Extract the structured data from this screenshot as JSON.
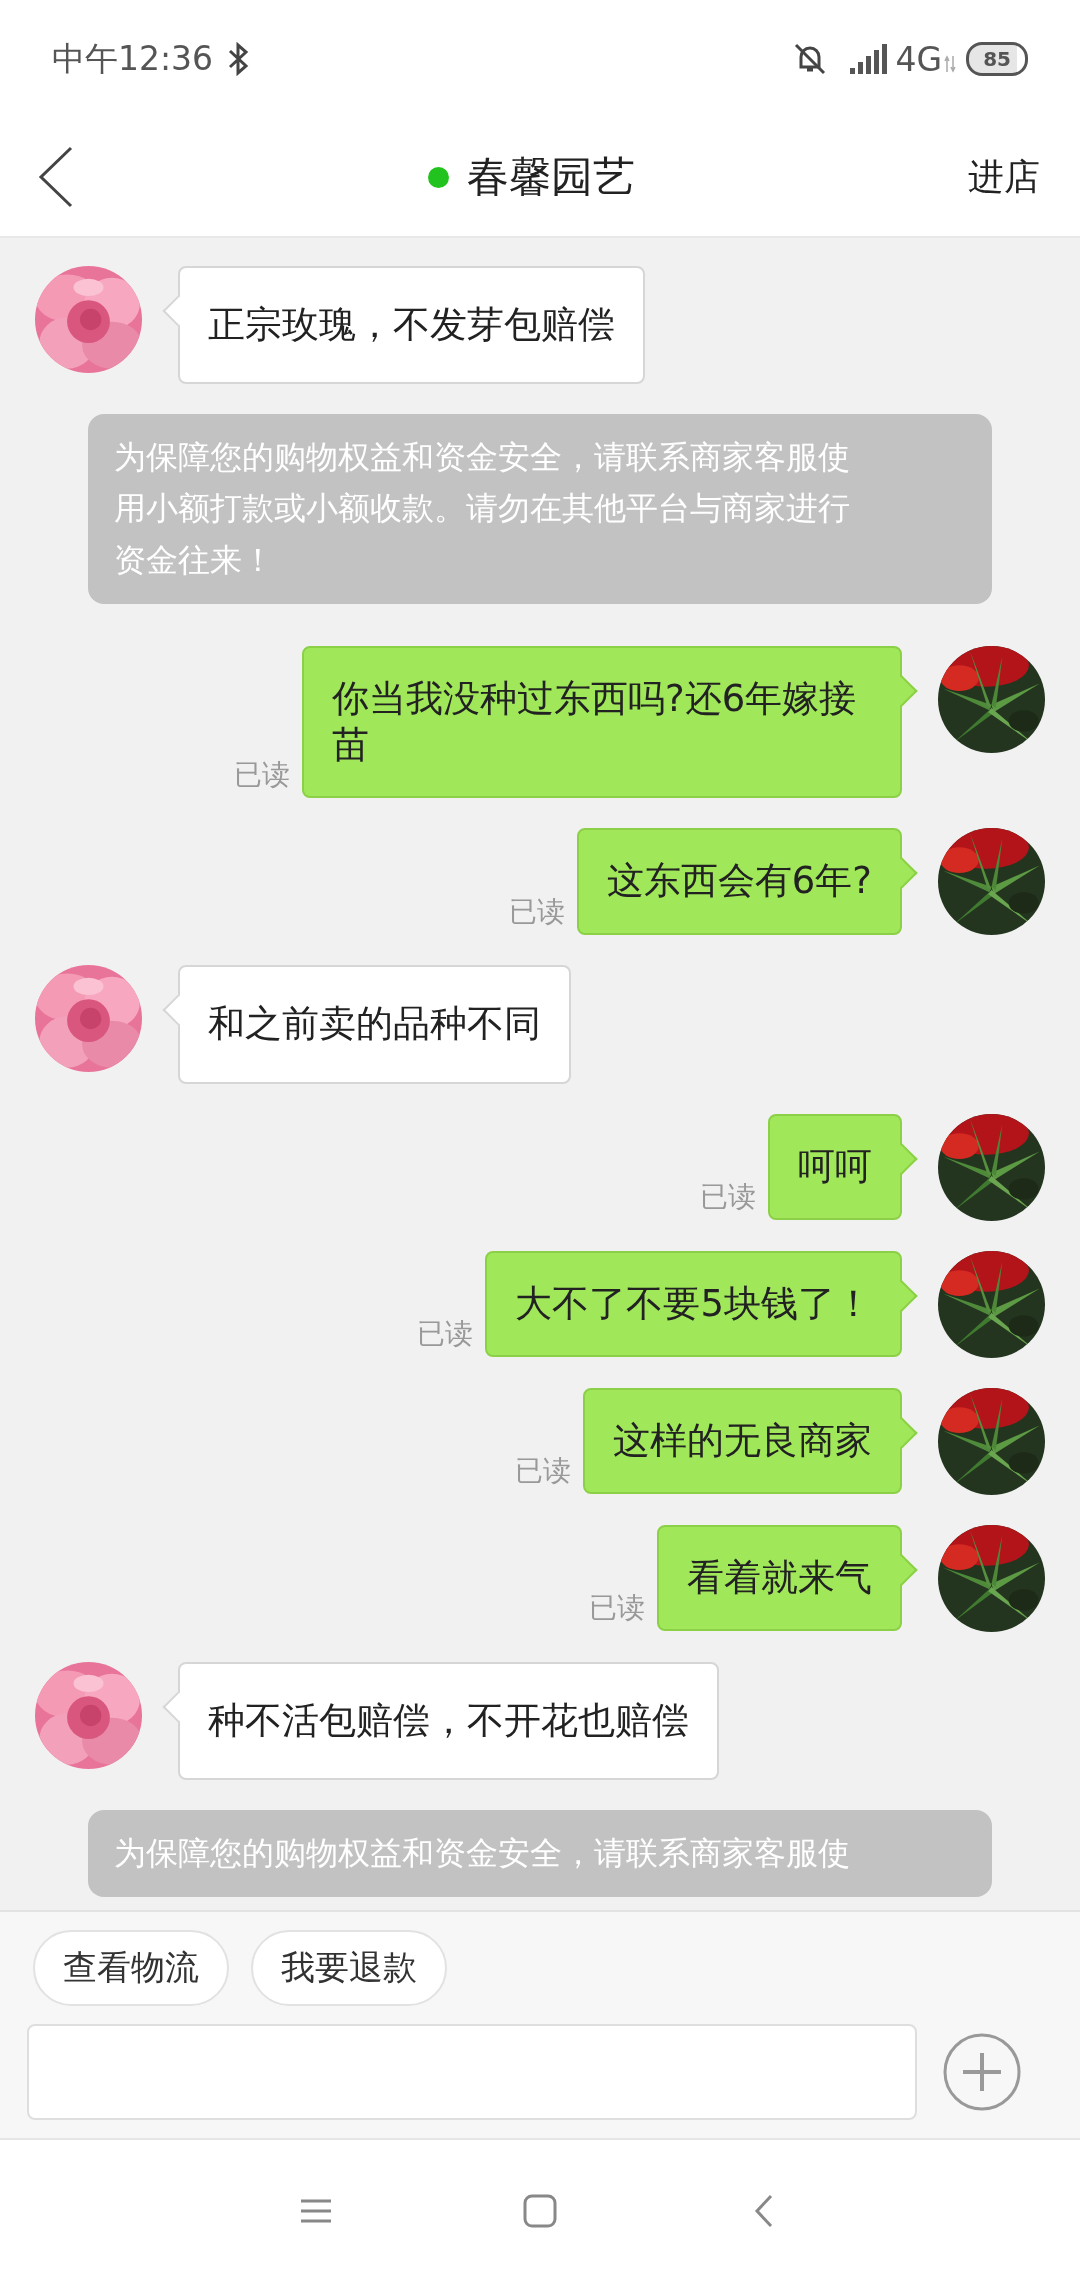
{
  "status_bar": {
    "time": "中午12:36",
    "network": "4G",
    "battery": "85"
  },
  "header": {
    "title": "春馨园艺",
    "online": true,
    "action": "进店"
  },
  "messages": [
    {
      "kind": "incoming",
      "text": "正宗玫瑰，不发芽包赔偿"
    },
    {
      "kind": "notice",
      "text": "为保障您的购物权益和资金安全，请联系商家客服使用小额打款或小额收款。请勿在其他平台与商家进行资金往来！"
    },
    {
      "kind": "outgoing",
      "text": "你当我没种过东西吗?还6年嫁接苗",
      "status": "已读"
    },
    {
      "kind": "outgoing",
      "text": "这东西会有6年?",
      "status": "已读"
    },
    {
      "kind": "incoming",
      "text": "和之前卖的品种不同"
    },
    {
      "kind": "outgoing",
      "text": "呵呵",
      "status": "已读"
    },
    {
      "kind": "outgoing",
      "text": "大不了不要5块钱了！",
      "status": "已读"
    },
    {
      "kind": "outgoing",
      "text": "这样的无良商家",
      "status": "已读"
    },
    {
      "kind": "outgoing",
      "text": "看着就来气",
      "status": "已读"
    },
    {
      "kind": "incoming",
      "text": "种不活包赔偿，不开花也赔偿"
    },
    {
      "kind": "notice",
      "text": "为保障您的购物权益和资金安全，请联系商家客服使"
    }
  ],
  "quick_replies": [
    "查看物流",
    "我要退款"
  ]
}
